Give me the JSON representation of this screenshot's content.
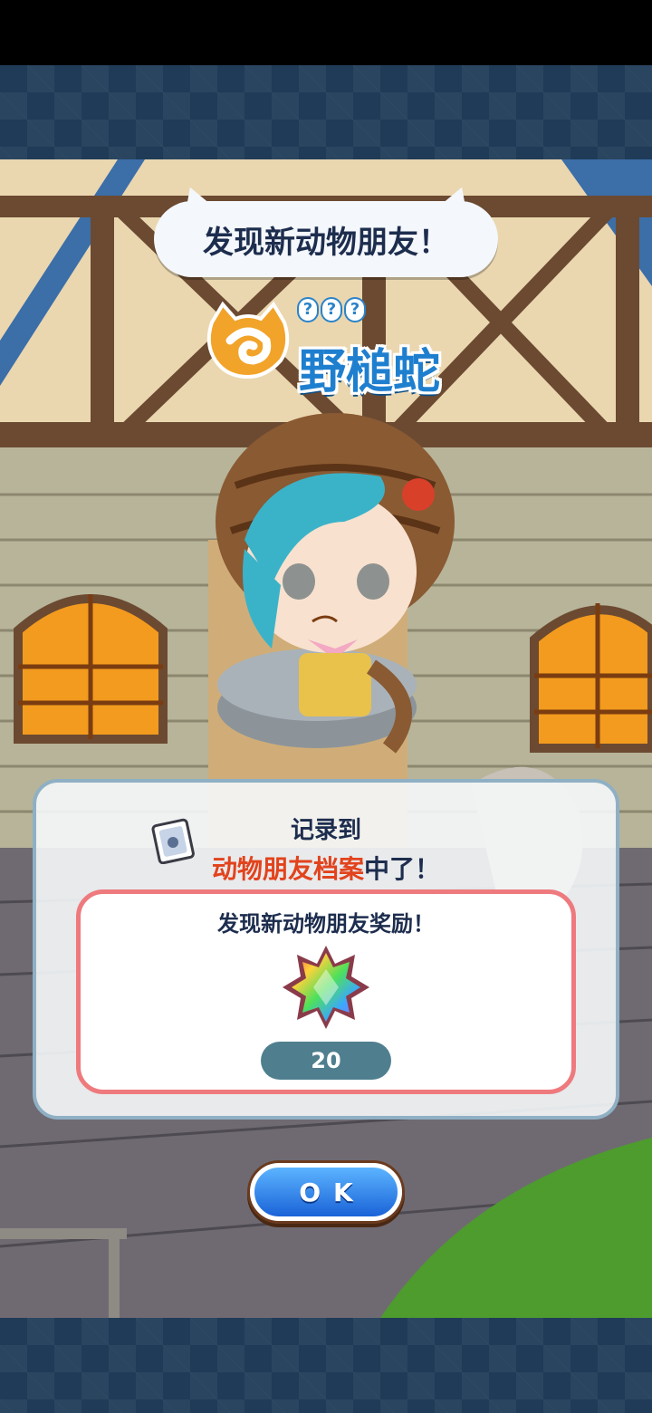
{
  "header": {
    "title": "发现新动物朋友！"
  },
  "friend": {
    "unknown_marks": [
      "?",
      "?",
      "?"
    ],
    "name": "野槌蛇"
  },
  "record": {
    "line1": "记录到",
    "highlight": "动物朋友档案",
    "suffix": "中了！"
  },
  "reward": {
    "title": "发现新动物朋友奖励！",
    "item_icon": "rainbow-gem-icon",
    "count": "20"
  },
  "ok_button": {
    "label": "OK"
  },
  "colors": {
    "frame": "#1f3b57",
    "accent_blue": "#1f7fcf",
    "highlight_red": "#e2431c",
    "reward_border": "#ee7a7e",
    "pill": "#4f7f8f"
  }
}
